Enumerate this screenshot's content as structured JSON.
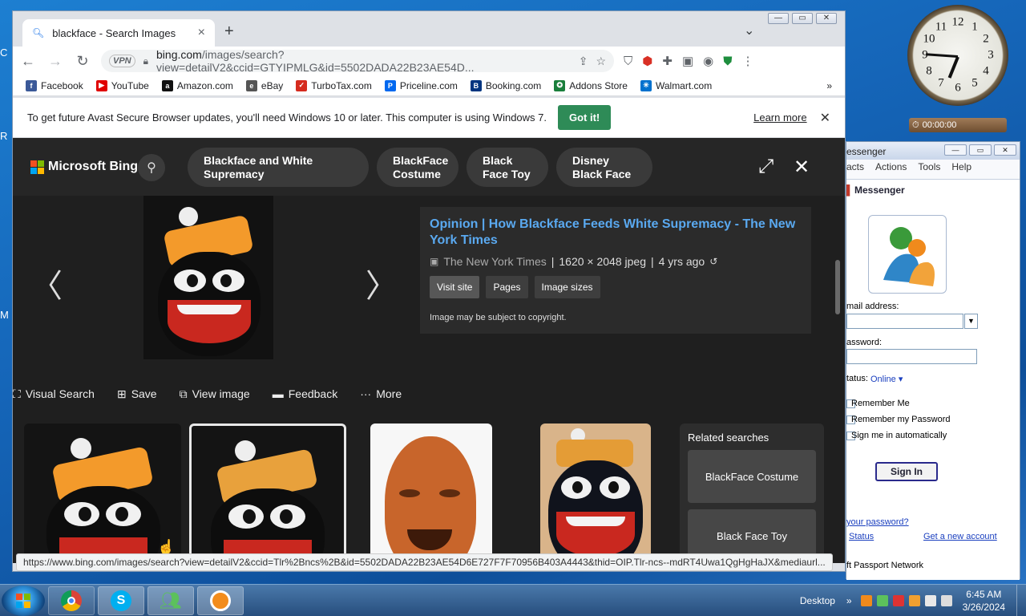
{
  "desktop": {
    "edge_letters": [
      "C",
      "R",
      "M"
    ]
  },
  "clock": {
    "numerals": [
      "12",
      "1",
      "2",
      "3",
      "4",
      "5",
      "6",
      "7",
      "8",
      "9",
      "10",
      "11"
    ]
  },
  "timer": {
    "time": "00:00:00"
  },
  "browser": {
    "tab_title": "blackface - Search Images",
    "tab_close": "×",
    "new_tab": "+",
    "tab_menu": "⌄",
    "vpn": "VPN",
    "url_host": "bing.com",
    "url_rest": "/images/search?view=detailV2&ccid=GTYIPMLG&id=5502DADA22B23AE54D...",
    "bookmarks": [
      {
        "label": "Facebook",
        "icon": "facebook-icon",
        "color": "#3b5998",
        "glyph": "f"
      },
      {
        "label": "YouTube",
        "icon": "youtube-icon",
        "color": "#e00000",
        "glyph": "▶"
      },
      {
        "label": "Amazon.com",
        "icon": "amazon-icon",
        "color": "#111111",
        "glyph": "a"
      },
      {
        "label": "eBay",
        "icon": "ebay-icon",
        "color": "#555555",
        "glyph": "e"
      },
      {
        "label": "TurboTax.com",
        "icon": "turbotax-icon",
        "color": "#d52b1e",
        "glyph": "✓"
      },
      {
        "label": "Priceline.com",
        "icon": "priceline-icon",
        "color": "#0068ef",
        "glyph": "P"
      },
      {
        "label": "Booking.com",
        "icon": "booking-icon",
        "color": "#003580",
        "glyph": "B"
      },
      {
        "label": "Addons Store",
        "icon": "addons-store-icon",
        "color": "#1a7f3c",
        "glyph": "✪"
      },
      {
        "label": "Walmart.com",
        "icon": "walmart-icon",
        "color": "#0071ce",
        "glyph": "✳"
      }
    ],
    "bookmarks_more": "»",
    "infobar": {
      "text": "To get future Avast Secure Browser updates, you'll need Windows 10 or later. This computer is using Windows 7.",
      "button": "Got it!",
      "learn_more": "Learn more",
      "close": "✕"
    },
    "status_url": "https://www.bing.com/images/search?view=detailV2&ccid=Tlr%2Bncs%2B&id=5502DADA22B23AE54D6E727F7F70956B403A4443&thid=OIP.Tlr-ncs--mdRT4Uwa1QgHgHaJX&mediaurl..."
  },
  "bing": {
    "brand": "Microsoft Bing",
    "pills": [
      "Blackface and White Supremacy",
      "BlackFace Costume",
      "Black Face Toy",
      "Disney Black Face"
    ],
    "result": {
      "title": "Opinion | How Blackface Feeds White Supremacy - The New York Times",
      "source": "The New York Times",
      "dimensions": "1620 × 2048 jpeg",
      "age": "4 yrs ago",
      "buttons": [
        "Visit site",
        "Pages",
        "Image sizes"
      ],
      "copyright": "Image may be subject to copyright."
    },
    "actions": [
      "Visual Search",
      "Save",
      "View image",
      "Feedback",
      "More"
    ],
    "related": {
      "heading": "Related searches",
      "items": [
        "BlackFace Costume",
        "Black Face Toy"
      ]
    }
  },
  "messenger": {
    "title": "essenger",
    "menu": [
      "acts",
      "Actions",
      "Tools",
      "Help"
    ],
    "header": "Messenger",
    "email_label": "mail address:",
    "password_label": "assword:",
    "status_label": "tatus:",
    "status_value": "Online",
    "checkboxes": [
      "Remember Me",
      "Remember my Password",
      "Sign me in automatically"
    ],
    "sign_in": "Sign In",
    "forgot": "your password?",
    "service_status": "Status",
    "new_account": "Get a new account",
    "footer": "ft Passport Network"
  },
  "taskbar": {
    "desktop_label": "Desktop",
    "time": "6:45 AM",
    "date": "3/26/2024"
  }
}
